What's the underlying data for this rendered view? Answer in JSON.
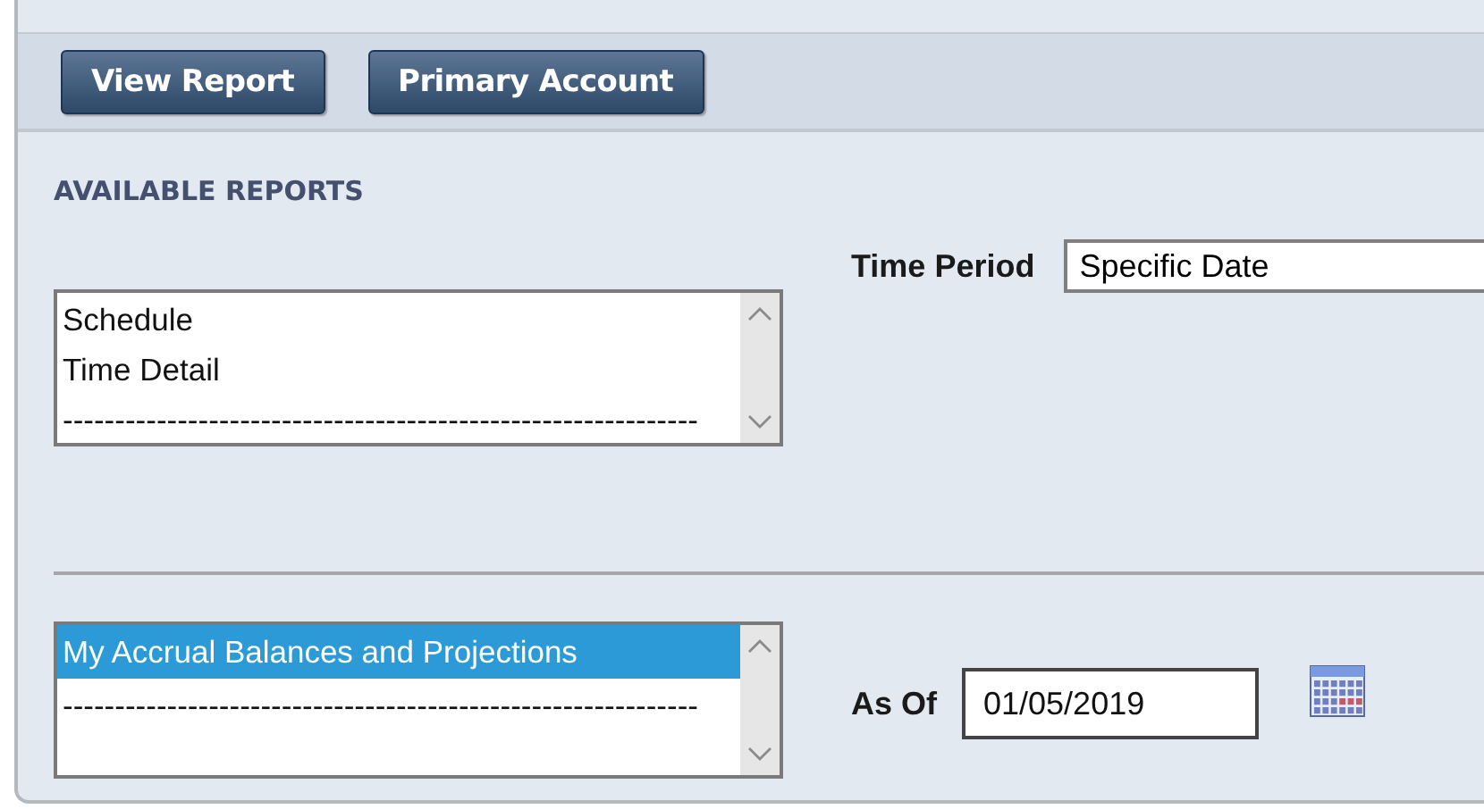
{
  "toolbar": {
    "buttons": [
      "View Report",
      "Primary Account"
    ]
  },
  "heading": "AVAILABLE REPORTS",
  "report_lists": [
    {
      "items": [
        {
          "label": "Schedule",
          "selected": false
        },
        {
          "label": "Time Detail",
          "selected": false
        },
        {
          "label": "-------------------------------------------------------------",
          "selected": false
        }
      ],
      "field": {
        "kind": "select",
        "label": "Time Period",
        "value": "Specific Date"
      }
    },
    {
      "items": [
        {
          "label": "My Accrual Balances and Projections",
          "selected": true
        },
        {
          "label": "-------------------------------------------------------------",
          "selected": false
        }
      ],
      "field": {
        "kind": "date",
        "label": "As Of",
        "value": "01/05/2019"
      }
    }
  ]
}
